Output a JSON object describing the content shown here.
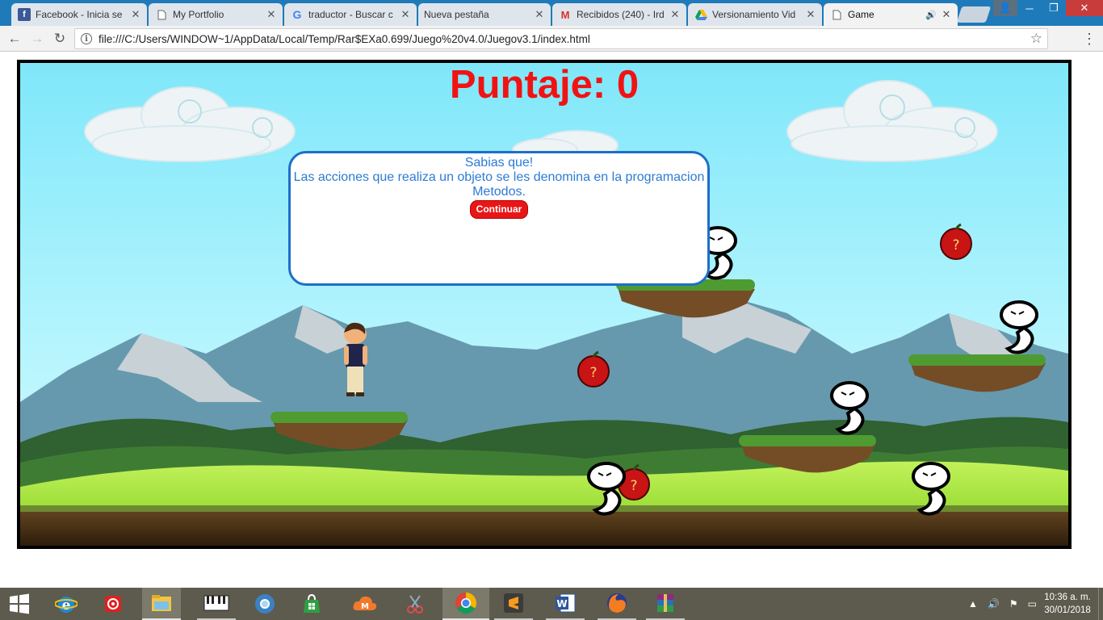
{
  "browser": {
    "tabs": [
      {
        "title": "Facebook - Inicia se",
        "favicon": "facebook-icon"
      },
      {
        "title": "My Portfolio",
        "favicon": "page-icon"
      },
      {
        "title": "traductor - Buscar c",
        "favicon": "google-icon"
      },
      {
        "title": "Nueva pestaña",
        "favicon": "none"
      },
      {
        "title": "Recibidos (240) - Ird",
        "favicon": "gmail-icon"
      },
      {
        "title": "Versionamiento Vid",
        "favicon": "drive-icon"
      },
      {
        "title": "Game",
        "favicon": "page-icon",
        "active": true
      }
    ],
    "url": "file:///C:/Users/WINDOW~1/AppData/Local/Temp/Rar$EXa0.699/Juego%20v4.0/Juegov3.1/index.html",
    "colors": {
      "tabstrip": "#1f7ab9",
      "close_button": "#c83c3c"
    }
  },
  "game": {
    "score_label": "Puntaje: 0",
    "score_value": 0,
    "dialog": {
      "heading": "Sabias que!",
      "message": "Las acciones que realiza un objeto se les denomina en la programacion Metodos.",
      "button": "Continuar"
    },
    "colors": {
      "score": "#f11313",
      "dialog_border": "#1d6fc9",
      "dialog_text": "#2c7bd3",
      "button": "#e81717"
    }
  },
  "taskbar": {
    "apps": [
      "windows-start-icon",
      "internet-explorer-icon",
      "media-player-icon",
      "file-explorer-icon",
      "piano-app-icon",
      "chrome-canary-icon",
      "store-icon",
      "mega-cloud-icon",
      "snipping-tool-icon",
      "chrome-icon",
      "sublime-text-icon",
      "word-icon",
      "firefox-icon",
      "winrar-icon"
    ],
    "time": "10:36 a. m.",
    "date": "30/01/2018"
  }
}
